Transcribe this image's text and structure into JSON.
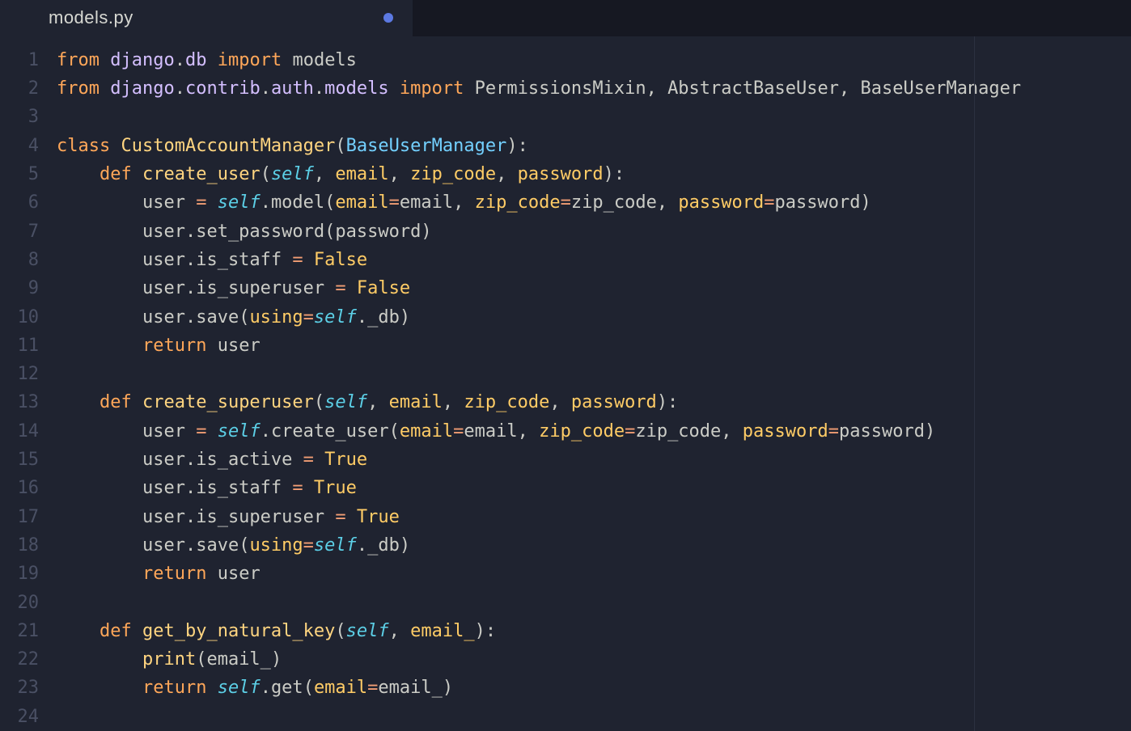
{
  "tab": {
    "filename": "models.py",
    "modified": true
  },
  "colors": {
    "background": "#1f2330",
    "tab_bar": "#161822",
    "gutter": "#4a5064",
    "ruler": "#2b3040",
    "keyword": "#ffa759",
    "module_ident": "#d4bfff",
    "identifier": "#cbccc6",
    "class_name": "#ffd580",
    "type_name": "#73d0ff",
    "function_name": "#ffd580",
    "parameter": "#ffcc66",
    "self": "#5ccfe6",
    "operator": "#f29e74",
    "boolean": "#ffcc66",
    "modified_dot": "#5c79e2"
  },
  "ruler_column": 80,
  "line_count": 24,
  "code_lines": [
    [
      {
        "t": "from",
        "c": "kw"
      },
      {
        "t": " ",
        "c": "punc"
      },
      {
        "t": "django",
        "c": "mod"
      },
      {
        "t": ".",
        "c": "punc"
      },
      {
        "t": "db",
        "c": "mod"
      },
      {
        "t": " ",
        "c": "punc"
      },
      {
        "t": "import",
        "c": "kw"
      },
      {
        "t": " ",
        "c": "punc"
      },
      {
        "t": "models",
        "c": "name"
      }
    ],
    [
      {
        "t": "from",
        "c": "kw"
      },
      {
        "t": " ",
        "c": "punc"
      },
      {
        "t": "django",
        "c": "mod"
      },
      {
        "t": ".",
        "c": "punc"
      },
      {
        "t": "contrib",
        "c": "mod"
      },
      {
        "t": ".",
        "c": "punc"
      },
      {
        "t": "auth",
        "c": "mod"
      },
      {
        "t": ".",
        "c": "punc"
      },
      {
        "t": "models",
        "c": "mod"
      },
      {
        "t": " ",
        "c": "punc"
      },
      {
        "t": "import",
        "c": "kw"
      },
      {
        "t": " ",
        "c": "punc"
      },
      {
        "t": "PermissionsMixin",
        "c": "name"
      },
      {
        "t": ", ",
        "c": "punc"
      },
      {
        "t": "AbstractBaseUser",
        "c": "name"
      },
      {
        "t": ", ",
        "c": "punc"
      },
      {
        "t": "BaseUserManager",
        "c": "name"
      }
    ],
    [],
    [
      {
        "t": "class",
        "c": "kw"
      },
      {
        "t": " ",
        "c": "punc"
      },
      {
        "t": "CustomAccountManager",
        "c": "cls"
      },
      {
        "t": "(",
        "c": "punc"
      },
      {
        "t": "BaseUserManager",
        "c": "base"
      },
      {
        "t": "):",
        "c": "punc"
      }
    ],
    [
      {
        "t": "    ",
        "c": "punc"
      },
      {
        "t": "def",
        "c": "kw"
      },
      {
        "t": " ",
        "c": "punc"
      },
      {
        "t": "create_user",
        "c": "func"
      },
      {
        "t": "(",
        "c": "punc"
      },
      {
        "t": "self",
        "c": "self"
      },
      {
        "t": ", ",
        "c": "punc"
      },
      {
        "t": "email",
        "c": "param"
      },
      {
        "t": ", ",
        "c": "punc"
      },
      {
        "t": "zip_code",
        "c": "param"
      },
      {
        "t": ", ",
        "c": "punc"
      },
      {
        "t": "password",
        "c": "param"
      },
      {
        "t": "):",
        "c": "punc"
      }
    ],
    [
      {
        "t": "        ",
        "c": "punc"
      },
      {
        "t": "user ",
        "c": "name"
      },
      {
        "t": "=",
        "c": "op"
      },
      {
        "t": " ",
        "c": "punc"
      },
      {
        "t": "self",
        "c": "self"
      },
      {
        "t": ".",
        "c": "punc"
      },
      {
        "t": "model",
        "c": "name"
      },
      {
        "t": "(",
        "c": "punc"
      },
      {
        "t": "email",
        "c": "param"
      },
      {
        "t": "=",
        "c": "op"
      },
      {
        "t": "email",
        "c": "name"
      },
      {
        "t": ", ",
        "c": "punc"
      },
      {
        "t": "zip_code",
        "c": "param"
      },
      {
        "t": "=",
        "c": "op"
      },
      {
        "t": "zip_code",
        "c": "name"
      },
      {
        "t": ", ",
        "c": "punc"
      },
      {
        "t": "password",
        "c": "param"
      },
      {
        "t": "=",
        "c": "op"
      },
      {
        "t": "password",
        "c": "name"
      },
      {
        "t": ")",
        "c": "punc"
      }
    ],
    [
      {
        "t": "        ",
        "c": "punc"
      },
      {
        "t": "user",
        "c": "name"
      },
      {
        "t": ".",
        "c": "punc"
      },
      {
        "t": "set_password",
        "c": "name"
      },
      {
        "t": "(",
        "c": "punc"
      },
      {
        "t": "password",
        "c": "name"
      },
      {
        "t": ")",
        "c": "punc"
      }
    ],
    [
      {
        "t": "        ",
        "c": "punc"
      },
      {
        "t": "user",
        "c": "name"
      },
      {
        "t": ".",
        "c": "punc"
      },
      {
        "t": "is_staff ",
        "c": "name"
      },
      {
        "t": "=",
        "c": "op"
      },
      {
        "t": " ",
        "c": "punc"
      },
      {
        "t": "False",
        "c": "bool"
      }
    ],
    [
      {
        "t": "        ",
        "c": "punc"
      },
      {
        "t": "user",
        "c": "name"
      },
      {
        "t": ".",
        "c": "punc"
      },
      {
        "t": "is_superuser ",
        "c": "name"
      },
      {
        "t": "=",
        "c": "op"
      },
      {
        "t": " ",
        "c": "punc"
      },
      {
        "t": "False",
        "c": "bool"
      }
    ],
    [
      {
        "t": "        ",
        "c": "punc"
      },
      {
        "t": "user",
        "c": "name"
      },
      {
        "t": ".",
        "c": "punc"
      },
      {
        "t": "save",
        "c": "name"
      },
      {
        "t": "(",
        "c": "punc"
      },
      {
        "t": "using",
        "c": "param"
      },
      {
        "t": "=",
        "c": "op"
      },
      {
        "t": "self",
        "c": "self"
      },
      {
        "t": ".",
        "c": "punc"
      },
      {
        "t": "_db",
        "c": "name"
      },
      {
        "t": ")",
        "c": "punc"
      }
    ],
    [
      {
        "t": "        ",
        "c": "punc"
      },
      {
        "t": "return",
        "c": "kw"
      },
      {
        "t": " ",
        "c": "punc"
      },
      {
        "t": "user",
        "c": "name"
      }
    ],
    [],
    [
      {
        "t": "    ",
        "c": "punc"
      },
      {
        "t": "def",
        "c": "kw"
      },
      {
        "t": " ",
        "c": "punc"
      },
      {
        "t": "create_superuser",
        "c": "func"
      },
      {
        "t": "(",
        "c": "punc"
      },
      {
        "t": "self",
        "c": "self"
      },
      {
        "t": ", ",
        "c": "punc"
      },
      {
        "t": "email",
        "c": "param"
      },
      {
        "t": ", ",
        "c": "punc"
      },
      {
        "t": "zip_code",
        "c": "param"
      },
      {
        "t": ", ",
        "c": "punc"
      },
      {
        "t": "password",
        "c": "param"
      },
      {
        "t": "):",
        "c": "punc"
      }
    ],
    [
      {
        "t": "        ",
        "c": "punc"
      },
      {
        "t": "user ",
        "c": "name"
      },
      {
        "t": "=",
        "c": "op"
      },
      {
        "t": " ",
        "c": "punc"
      },
      {
        "t": "self",
        "c": "self"
      },
      {
        "t": ".",
        "c": "punc"
      },
      {
        "t": "create_user",
        "c": "name"
      },
      {
        "t": "(",
        "c": "punc"
      },
      {
        "t": "email",
        "c": "param"
      },
      {
        "t": "=",
        "c": "op"
      },
      {
        "t": "email",
        "c": "name"
      },
      {
        "t": ", ",
        "c": "punc"
      },
      {
        "t": "zip_code",
        "c": "param"
      },
      {
        "t": "=",
        "c": "op"
      },
      {
        "t": "zip_code",
        "c": "name"
      },
      {
        "t": ", ",
        "c": "punc"
      },
      {
        "t": "password",
        "c": "param"
      },
      {
        "t": "=",
        "c": "op"
      },
      {
        "t": "password",
        "c": "name"
      },
      {
        "t": ")",
        "c": "punc"
      }
    ],
    [
      {
        "t": "        ",
        "c": "punc"
      },
      {
        "t": "user",
        "c": "name"
      },
      {
        "t": ".",
        "c": "punc"
      },
      {
        "t": "is_active ",
        "c": "name"
      },
      {
        "t": "=",
        "c": "op"
      },
      {
        "t": " ",
        "c": "punc"
      },
      {
        "t": "True",
        "c": "bool"
      }
    ],
    [
      {
        "t": "        ",
        "c": "punc"
      },
      {
        "t": "user",
        "c": "name"
      },
      {
        "t": ".",
        "c": "punc"
      },
      {
        "t": "is_staff ",
        "c": "name"
      },
      {
        "t": "=",
        "c": "op"
      },
      {
        "t": " ",
        "c": "punc"
      },
      {
        "t": "True",
        "c": "bool"
      }
    ],
    [
      {
        "t": "        ",
        "c": "punc"
      },
      {
        "t": "user",
        "c": "name"
      },
      {
        "t": ".",
        "c": "punc"
      },
      {
        "t": "is_superuser ",
        "c": "name"
      },
      {
        "t": "=",
        "c": "op"
      },
      {
        "t": " ",
        "c": "punc"
      },
      {
        "t": "True",
        "c": "bool"
      }
    ],
    [
      {
        "t": "        ",
        "c": "punc"
      },
      {
        "t": "user",
        "c": "name"
      },
      {
        "t": ".",
        "c": "punc"
      },
      {
        "t": "save",
        "c": "name"
      },
      {
        "t": "(",
        "c": "punc"
      },
      {
        "t": "using",
        "c": "param"
      },
      {
        "t": "=",
        "c": "op"
      },
      {
        "t": "self",
        "c": "self"
      },
      {
        "t": ".",
        "c": "punc"
      },
      {
        "t": "_db",
        "c": "name"
      },
      {
        "t": ")",
        "c": "punc"
      }
    ],
    [
      {
        "t": "        ",
        "c": "punc"
      },
      {
        "t": "return",
        "c": "kw"
      },
      {
        "t": " ",
        "c": "punc"
      },
      {
        "t": "user",
        "c": "name"
      }
    ],
    [],
    [
      {
        "t": "    ",
        "c": "punc"
      },
      {
        "t": "def",
        "c": "kw"
      },
      {
        "t": " ",
        "c": "punc"
      },
      {
        "t": "get_by_natural_key",
        "c": "func"
      },
      {
        "t": "(",
        "c": "punc"
      },
      {
        "t": "self",
        "c": "self"
      },
      {
        "t": ", ",
        "c": "punc"
      },
      {
        "t": "email_",
        "c": "param"
      },
      {
        "t": "):",
        "c": "punc"
      }
    ],
    [
      {
        "t": "        ",
        "c": "punc"
      },
      {
        "t": "print",
        "c": "builtin"
      },
      {
        "t": "(",
        "c": "punc"
      },
      {
        "t": "email_",
        "c": "name"
      },
      {
        "t": ")",
        "c": "punc"
      }
    ],
    [
      {
        "t": "        ",
        "c": "punc"
      },
      {
        "t": "return",
        "c": "kw"
      },
      {
        "t": " ",
        "c": "punc"
      },
      {
        "t": "self",
        "c": "self"
      },
      {
        "t": ".",
        "c": "punc"
      },
      {
        "t": "get",
        "c": "name"
      },
      {
        "t": "(",
        "c": "punc"
      },
      {
        "t": "email",
        "c": "param"
      },
      {
        "t": "=",
        "c": "op"
      },
      {
        "t": "email_",
        "c": "name"
      },
      {
        "t": ")",
        "c": "punc"
      }
    ],
    []
  ]
}
